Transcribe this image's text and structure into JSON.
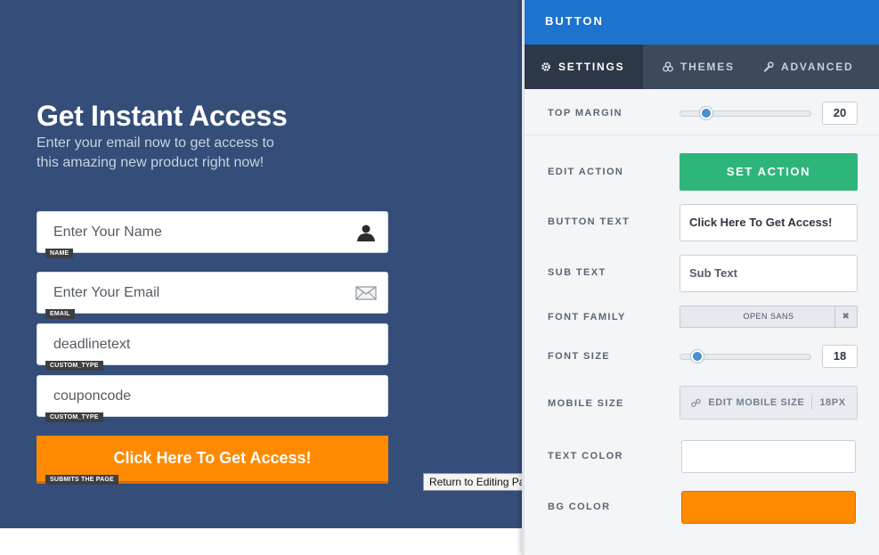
{
  "preview": {
    "headline": "Get Instant Access",
    "subheadline_line1": "Enter your email now to get access to",
    "subheadline_line2": "this amazing new product right now!",
    "fields": [
      {
        "placeholder": "Enter Your Name",
        "tag": "NAME",
        "icon": "user-icon"
      },
      {
        "placeholder": "Enter Your Email",
        "tag": "EMAIL",
        "icon": "envelope-icon"
      },
      {
        "placeholder": "deadlinetext",
        "tag": "CUSTOM_TYPE"
      },
      {
        "placeholder": "couponcode",
        "tag": "CUSTOM_TYPE"
      }
    ],
    "button_label": "Click Here To Get Access!",
    "button_tag": "SUBMITS THE PAGE",
    "tooltip": "Return to Editing Page",
    "colors": {
      "background": "#344e79",
      "button": "#ff8a00"
    }
  },
  "panel": {
    "title": "BUTTON",
    "tabs": [
      {
        "label": "SETTINGS",
        "icon": "gear-icon",
        "active": true
      },
      {
        "label": "THEMES",
        "icon": "themes-icon",
        "active": false
      },
      {
        "label": "ADVANCED",
        "icon": "wrench-icon",
        "active": false
      }
    ],
    "top_margin": {
      "label": "TOP MARGIN",
      "value": "20"
    },
    "edit_action": {
      "label": "EDIT ACTION",
      "button": "SET ACTION"
    },
    "button_text": {
      "label": "BUTTON TEXT",
      "value": "Click Here To Get Access!"
    },
    "sub_text": {
      "label": "SUB TEXT",
      "value": "Sub Text"
    },
    "font_family": {
      "label": "FONT FAMILY",
      "value": "OPEN SANS"
    },
    "font_size": {
      "label": "FONT SIZE",
      "value": "18"
    },
    "mobile_size": {
      "label": "MOBILE SIZE",
      "button": "EDIT MOBILE SIZE",
      "value": "18PX"
    },
    "text_color": {
      "label": "TEXT COLOR",
      "value": "#ffffff"
    },
    "bg_color": {
      "label": "BG COLOR",
      "value": "#ff8a00"
    },
    "colors": {
      "header": "#1d73cd",
      "tabs": "#3c4a5c",
      "set_action": "#2eb57a"
    }
  }
}
